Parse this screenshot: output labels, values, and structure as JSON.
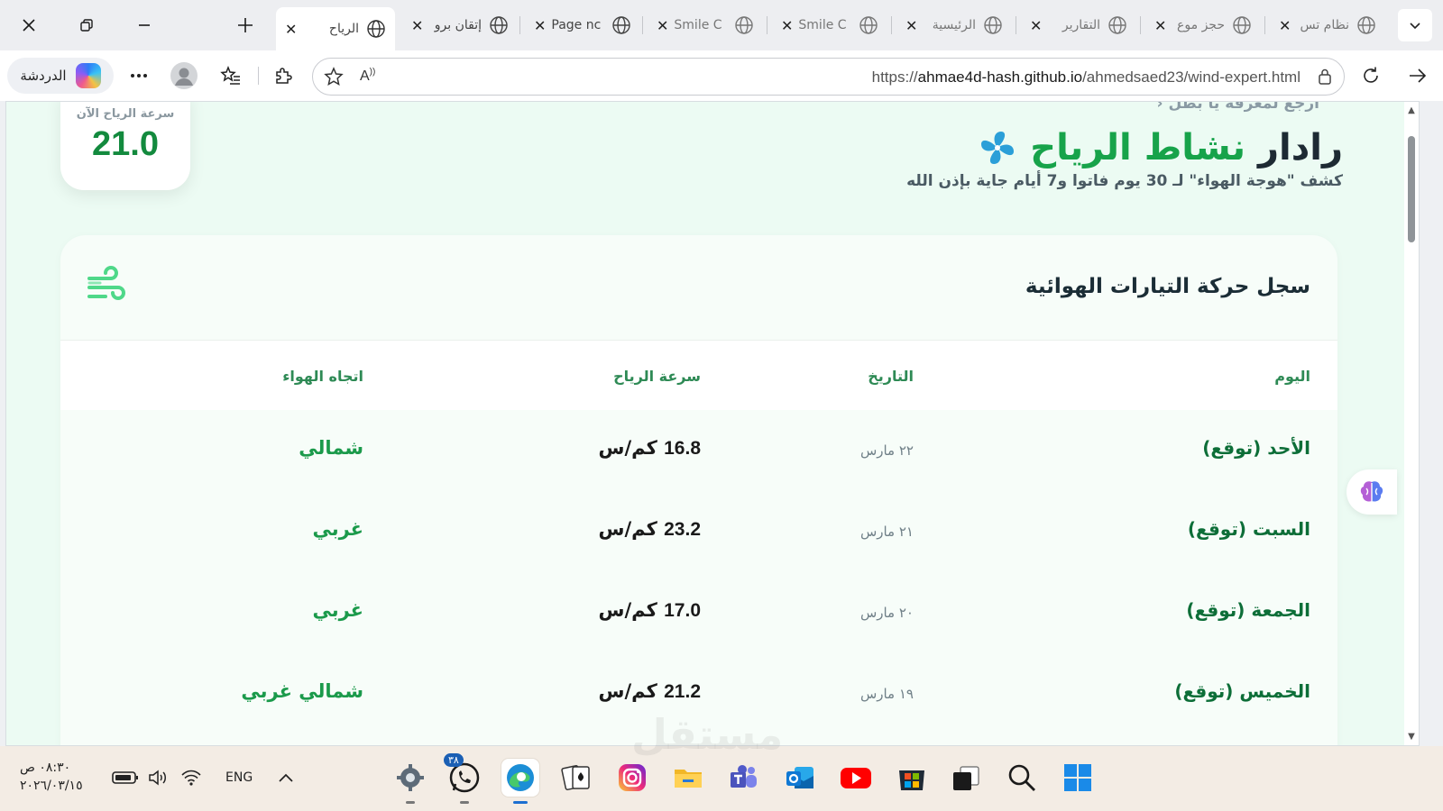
{
  "browser": {
    "tabs": [
      {
        "title": "الرياح",
        "active": true
      },
      {
        "title": "إتقان برو",
        "active": false
      },
      {
        "title": "Page nc",
        "active": false
      },
      {
        "title": "Smile C",
        "active": false
      },
      {
        "title": "Smile C",
        "active": false
      },
      {
        "title": "الرئيسية",
        "active": false
      },
      {
        "title": "التقارير",
        "active": false
      },
      {
        "title": "حجز موع",
        "active": false
      },
      {
        "title": "نظام تس",
        "active": false
      }
    ],
    "copilot_label": "الدردشة",
    "url_prefix": "https://",
    "url_host": "ahmae4d-hash.github.io",
    "url_path": "/ahmedsaed23/wind-expert.html"
  },
  "page": {
    "back_link": "ارجع لمعرفة يا بطل",
    "title_main": "رادار",
    "title_accent": "نشاط الرياح",
    "subtitle": "كشف \"هوجة الهواء\" لـ 30 يوم فاتوا و7 أيام جاية بإذن الله",
    "current_speed_label": "سرعة الرياح الآن",
    "current_speed_value": "21.0",
    "log": {
      "title": "سجل حركة التيارات الهوائية",
      "headers": {
        "day": "اليوم",
        "date": "التاريخ",
        "speed": "سرعة الرياح",
        "direction": "اتجاه الهواء"
      },
      "rows": [
        {
          "day": "الأحد (توقع)",
          "date": "٢٢ مارس",
          "speed": "16.8",
          "unit": "كم/س",
          "direction": "شمالي"
        },
        {
          "day": "السبت (توقع)",
          "date": "٢١ مارس",
          "speed": "23.2",
          "unit": "كم/س",
          "direction": "غربي"
        },
        {
          "day": "الجمعة (توقع)",
          "date": "٢٠ مارس",
          "speed": "17.0",
          "unit": "كم/س",
          "direction": "غربي"
        },
        {
          "day": "الخميس (توقع)",
          "date": "١٩ مارس",
          "speed": "21.2",
          "unit": "كم/س",
          "direction": "شمالي غربي"
        }
      ]
    }
  },
  "taskbar": {
    "time": "٠٨:٣٠ ص",
    "date": "٢٠٢٦/٠٣/١٥",
    "language": "ENG",
    "whatsapp_badge": "٣٨",
    "watermark": "مستقل"
  },
  "colors": {
    "accent_green": "#17a34a",
    "page_bg": "#ecfbf3",
    "taskbar_bg": "#f3ece4"
  }
}
